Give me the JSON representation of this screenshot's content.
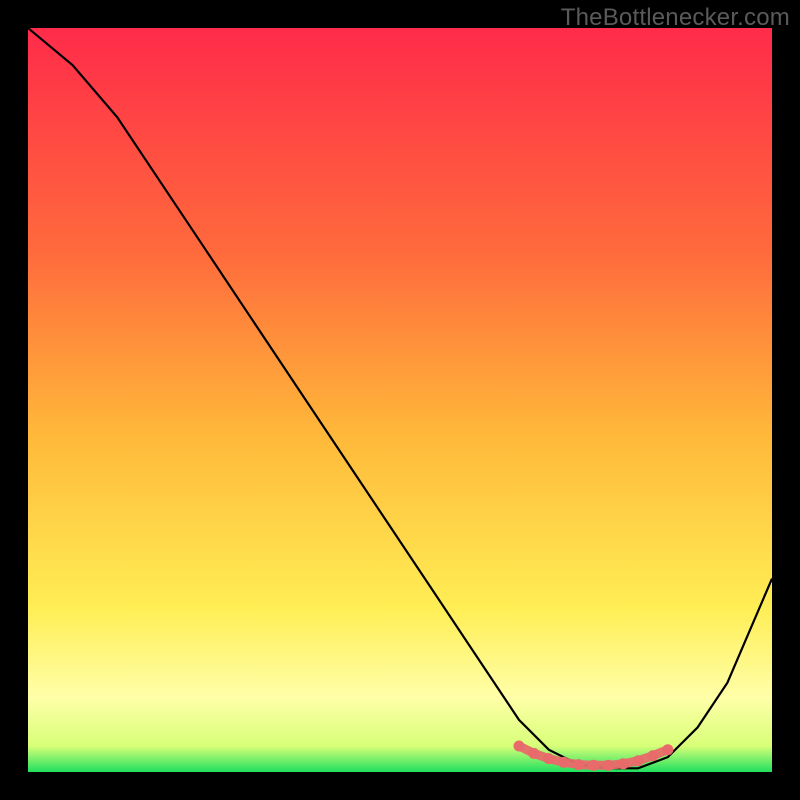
{
  "watermark": "TheBottlenecker.com",
  "colors": {
    "frame": "#000000",
    "grad_top": "#ff2b4a",
    "grad_mid1": "#ff7a3a",
    "grad_mid2": "#ffd23a",
    "grad_low": "#ffff9a",
    "grad_green": "#20e060",
    "curve": "#000000",
    "marker": "#e86a6a"
  },
  "chart_data": {
    "type": "line",
    "title": "",
    "xlabel": "",
    "ylabel": "",
    "xlim": [
      0,
      100
    ],
    "ylim": [
      0,
      100
    ],
    "series": [
      {
        "name": "bottleneck-curve",
        "x": [
          0,
          6,
          12,
          18,
          24,
          30,
          36,
          42,
          48,
          54,
          60,
          66,
          70,
          74,
          78,
          82,
          86,
          90,
          94,
          100
        ],
        "y": [
          100,
          95,
          88,
          79,
          70,
          61,
          52,
          43,
          34,
          25,
          16,
          7,
          3,
          1,
          0.5,
          0.5,
          2,
          6,
          12,
          26
        ]
      }
    ],
    "markers": {
      "name": "optimal-range",
      "x": [
        66,
        68,
        70,
        72,
        74,
        76,
        78,
        80,
        82,
        84,
        86
      ],
      "y": [
        3.5,
        2.5,
        1.8,
        1.3,
        1.0,
        0.9,
        0.9,
        1.1,
        1.5,
        2.2,
        3.0
      ]
    },
    "gradient_stops": [
      {
        "pos": 0.0,
        "color": "#ff2b4a"
      },
      {
        "pos": 0.3,
        "color": "#ff6a3c"
      },
      {
        "pos": 0.55,
        "color": "#ffb93a"
      },
      {
        "pos": 0.78,
        "color": "#ffee55"
      },
      {
        "pos": 0.9,
        "color": "#ffffa8"
      },
      {
        "pos": 0.965,
        "color": "#d8ff78"
      },
      {
        "pos": 1.0,
        "color": "#1fe05f"
      }
    ]
  }
}
